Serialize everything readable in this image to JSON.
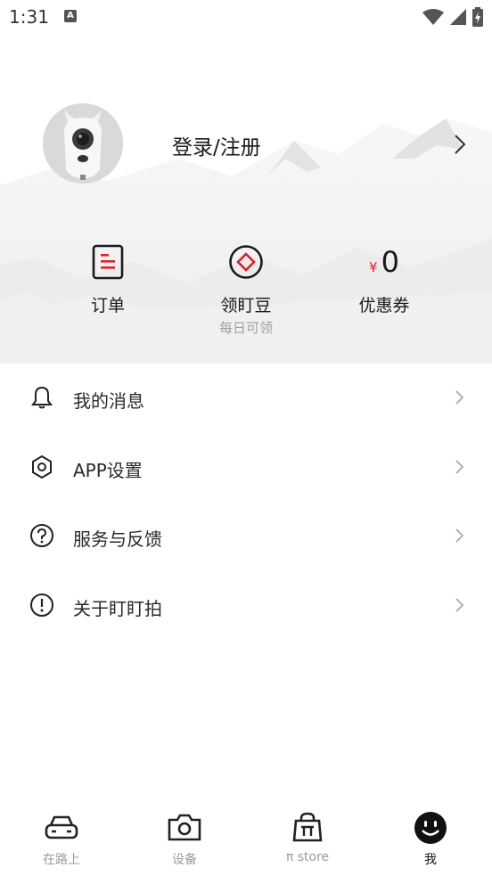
{
  "status_bar": {
    "time": "1:31",
    "indicator": "A"
  },
  "profile": {
    "login_label": "登录/注册"
  },
  "quick_actions": {
    "orders": {
      "label": "订单",
      "icon": "order-list-icon"
    },
    "beans": {
      "label": "领盯豆",
      "sub": "每日可领",
      "icon": "diamond-coin-icon"
    },
    "coupons": {
      "label": "优惠券",
      "currency": "¥",
      "amount": "0"
    }
  },
  "menu": [
    {
      "label": "我的消息",
      "icon": "bell-icon"
    },
    {
      "label": "APP设置",
      "icon": "hexagon-settings-icon"
    },
    {
      "label": "服务与反馈",
      "icon": "question-circle-icon"
    },
    {
      "label": "关于盯盯拍",
      "icon": "exclamation-circle-icon"
    }
  ],
  "bottom_nav": [
    {
      "label": "在路上",
      "icon": "car-icon",
      "active": false
    },
    {
      "label": "设备",
      "icon": "camera-icon",
      "active": false
    },
    {
      "label": "π store",
      "icon": "shopping-bag-icon",
      "active": false
    },
    {
      "label": "我",
      "icon": "smiley-icon",
      "active": true
    }
  ],
  "colors": {
    "accent": "#e0202a",
    "text": "#1a1a1a",
    "muted": "#9a9a9a"
  }
}
